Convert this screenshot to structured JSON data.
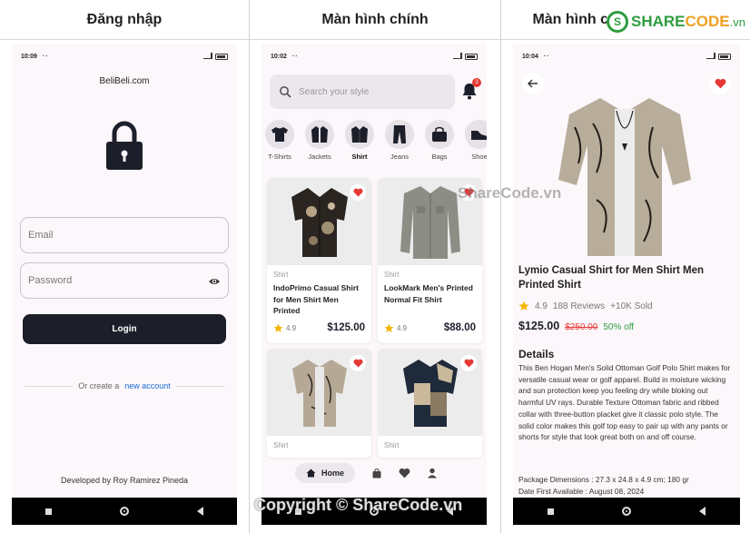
{
  "columns": {
    "login": "Đăng nhập",
    "home": "Màn hình chính",
    "detail": "Màn hình c"
  },
  "watermark": {
    "logo_share": "SHARE",
    "logo_code": "CODE",
    "logo_vn": ".vn",
    "mid": "ShareCode.vn",
    "bottom": "Copyright © ShareCode.vn"
  },
  "login": {
    "time": "10:09",
    "dots": "··",
    "brand": "BeliBeli.com",
    "email_placeholder": "Email",
    "password_placeholder": "Password",
    "login_label": "Login",
    "or_text": "Or create a",
    "new_account": "new account",
    "developer": "Developed by Roy Ramirez Pineda"
  },
  "home": {
    "time": "10:02",
    "dots": "··",
    "search_placeholder": "Search your style",
    "notif_count": "3",
    "categories": [
      "T-Shirts",
      "Jackets",
      "Shirt",
      "Jeans",
      "Bags",
      "Shoe"
    ],
    "products": [
      {
        "category": "Shirt",
        "name": "IndoPrimo Casual Shirt for Men Shirt Men Printed",
        "rating": "4.9",
        "price": "$125.00"
      },
      {
        "category": "Shirt",
        "name": "LookMark Men's Printed Normal Fit Shirt",
        "rating": "4.9",
        "price": "$88.00"
      },
      {
        "category": "Shirt",
        "name": "",
        "rating": "",
        "price": ""
      },
      {
        "category": "Shirt",
        "name": "",
        "rating": "",
        "price": ""
      }
    ],
    "nav_home": "Home"
  },
  "detail": {
    "time": "10:04",
    "dots": "··",
    "title": "Lymio Casual Shirt for Men Shirt Men Printed Shirt",
    "rating": "4.9",
    "reviews": "188 Reviews",
    "sold": "+10K Sold",
    "price": "$125.00",
    "old_price": "$250.00",
    "discount": "50% off",
    "details_heading": "Details",
    "description": "This Ben Hogan Men's Solid Ottoman Golf Polo Shirt makes for versatile casual wear or golf apparel. Build in moisture wicking and sun protection keep you feeling dry while bloking out harmful UV rays. Durable Texture Ottoman fabric and ribbed collar with three-button placket give it classic polo style. The solid color makes this golf top easy to pair up with any pants or shorts for style that look great both on and off course.",
    "spec_dimensions": "Package Dimensions  : 27.3 x 24.8 x 4.9 cm; 180 gr",
    "spec_date": "Date First Available    : August 08, 2024"
  },
  "colors": {
    "accent_dark": "#1c1f2a",
    "heart": "#e53935",
    "link": "#1a6fd1",
    "discount": "#2e9d3e",
    "star": "#f5b400"
  }
}
